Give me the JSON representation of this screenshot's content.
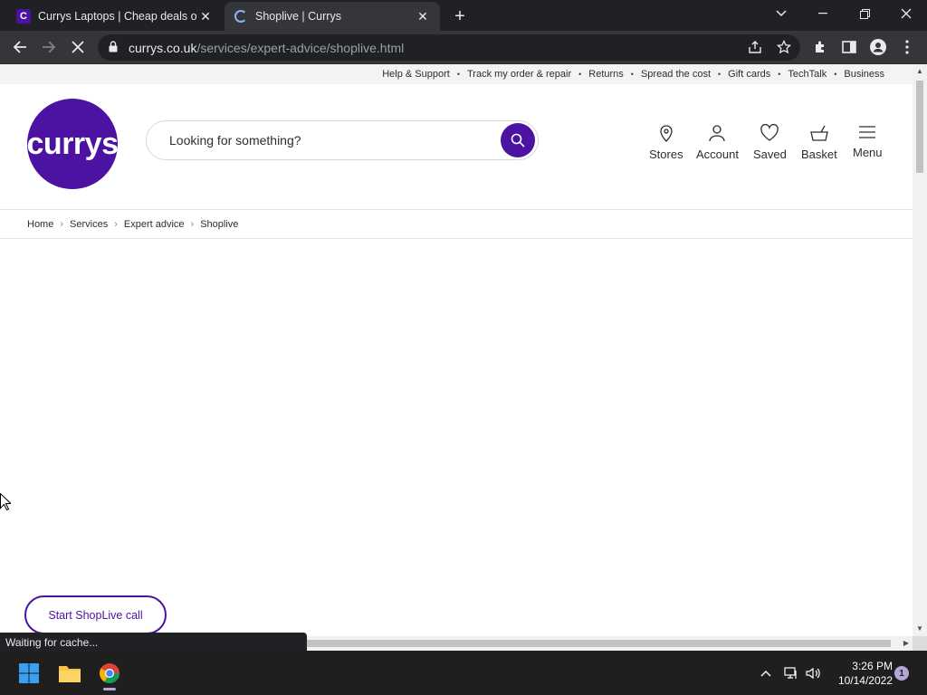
{
  "browser": {
    "tabs": [
      {
        "title": "Currys Laptops | Cheap deals on Windows",
        "favicon": "currys-c-icon",
        "active": false
      },
      {
        "title": "Shoplive | Currys",
        "favicon": "loading-spinner-icon",
        "active": true
      }
    ],
    "url_host": "currys.co.uk",
    "url_path": "/services/expert-advice/shoplive.html",
    "status_text": "Waiting for cache..."
  },
  "page": {
    "utility_links": [
      "Help & Support",
      "Track my order & repair",
      "Returns",
      "Spread the cost",
      "Gift cards",
      "TechTalk",
      "Business"
    ],
    "logo_text": "currys",
    "search_placeholder": "Looking for something?",
    "nav": [
      {
        "label": "Stores",
        "icon": "location-pin-icon"
      },
      {
        "label": "Account",
        "icon": "user-icon"
      },
      {
        "label": "Saved",
        "icon": "heart-icon"
      },
      {
        "label": "Basket",
        "icon": "basket-icon"
      },
      {
        "label": "Menu",
        "icon": "hamburger-menu-icon"
      }
    ],
    "breadcrumbs": [
      "Home",
      "Services",
      "Expert advice",
      "Shoplive"
    ],
    "cta_label": "Start ShopLive call"
  },
  "taskbar": {
    "time": "3:26 PM",
    "date": "10/14/2022",
    "notification_count": "1"
  },
  "colors": {
    "brand": "#4c12a1",
    "chrome_dark": "#202124",
    "chrome_toolbar": "#35363a"
  }
}
